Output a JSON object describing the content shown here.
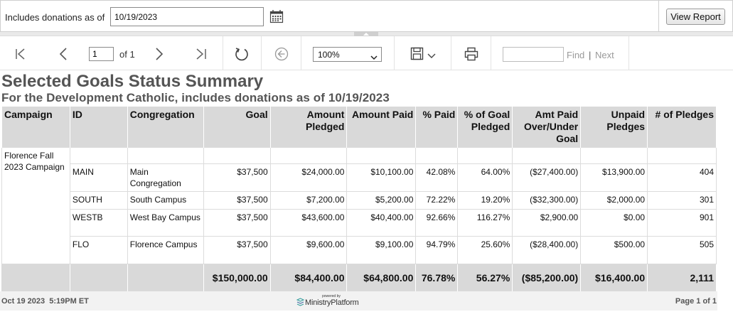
{
  "params": {
    "label": "Includes donations as of",
    "date_value": "10/19/2023",
    "view_report_label": "View Report"
  },
  "toolbar": {
    "page_value": "1",
    "of_text": "of 1",
    "zoom_value": "100%",
    "find_label": "Find",
    "separator": "|",
    "next_label": "Next"
  },
  "report": {
    "title": "Selected Goals Status Summary",
    "subtitle": "For the Development Catholic, includes donations as of 10/19/2023",
    "columns": [
      "Campaign",
      "ID",
      "Congregation",
      "Goal",
      "Amount Pledged",
      "Amount Paid",
      "% Paid",
      "% of Goal Pledged",
      "Amt Paid Over/Under Goal",
      "Unpaid Pledges",
      "# of Pledges"
    ],
    "campaign": "Florence Fall 2023 Campaign",
    "rows": [
      {
        "id": "MAIN",
        "congregation": "Main Congregation",
        "goal": "$37,500",
        "pledged": "$24,000.00",
        "paid": "$10,100.00",
        "pct_paid": "42.08%",
        "pct_goal": "64.00%",
        "over_under": "($27,400.00)",
        "unpaid": "$13,900.00",
        "pledges": "404"
      },
      {
        "id": "SOUTH",
        "congregation": "South Campus",
        "goal": "$37,500",
        "pledged": "$7,200.00",
        "paid": "$5,200.00",
        "pct_paid": "72.22%",
        "pct_goal": "19.20%",
        "over_under": "($32,300.00)",
        "unpaid": "$2,000.00",
        "pledges": "301"
      },
      {
        "id": "WESTB",
        "congregation": "West Bay Campus",
        "goal": "$37,500",
        "pledged": "$43,600.00",
        "paid": "$40,400.00",
        "pct_paid": "92.66%",
        "pct_goal": "116.27%",
        "over_under": "$2,900.00",
        "unpaid": "$0.00",
        "pledges": "901"
      },
      {
        "id": "FLO",
        "congregation": "Florence Campus",
        "goal": "$37,500",
        "pledged": "$9,600.00",
        "paid": "$9,100.00",
        "pct_paid": "94.79%",
        "pct_goal": "25.60%",
        "over_under": "($28,400.00)",
        "unpaid": "$500.00",
        "pledges": "505"
      }
    ],
    "totals": {
      "goal": "$150,000.00",
      "pledged": "$84,400.00",
      "paid": "$64,800.00",
      "pct_paid": "76.78%",
      "pct_goal": "56.27%",
      "over_under": "($85,200.00)",
      "unpaid": "$16,400.00",
      "pledges": "2,111"
    }
  },
  "footer": {
    "timestamp": "Oct 19 2023  5:19PM ET",
    "powered_by": "powered by",
    "brand": "MinistryPlatform",
    "page_info": "Page 1 of 1"
  },
  "icons": {
    "calendar": "calendar-icon",
    "first": "first-page-icon",
    "prev": "previous-page-icon",
    "next": "next-page-icon",
    "last": "last-page-icon",
    "refresh": "refresh-icon",
    "back": "back-icon",
    "save": "save-icon",
    "print": "print-icon"
  }
}
